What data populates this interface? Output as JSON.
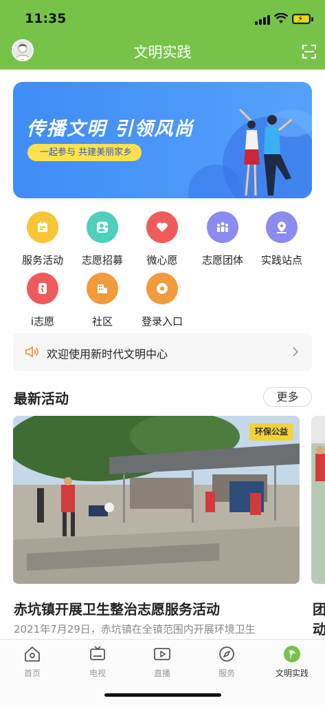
{
  "status_bar": {
    "time": "11:35"
  },
  "header": {
    "title": "文明实践",
    "avatar": "user-avatar",
    "scan_icon": "scan-icon"
  },
  "banner": {
    "title": "传播文明 引领风尚",
    "subtitle": "一起参与 共建美丽家乡"
  },
  "services": [
    {
      "label": "服务活动",
      "icon": "calendar-icon",
      "color": "#f7c636"
    },
    {
      "label": "志愿招募",
      "icon": "recruit-icon",
      "color": "#4fcfbd"
    },
    {
      "label": "微心愿",
      "icon": "heart-icon",
      "color": "#ef5a5a"
    },
    {
      "label": "志愿团体",
      "icon": "group-icon",
      "color": "#8b8bf0"
    },
    {
      "label": "实践站点",
      "icon": "location-icon",
      "color": "#8b8bf0"
    },
    {
      "label": "i志愿",
      "icon": "volunteer-icon",
      "color": "#ef5a5a"
    },
    {
      "label": "社区",
      "icon": "community-icon",
      "color": "#f39a3c"
    },
    {
      "label": "登录入口",
      "icon": "login-icon",
      "color": "#f39a3c"
    }
  ],
  "notice": {
    "text": "欢迎使用新时代文明中心",
    "icon": "speaker-icon"
  },
  "latest": {
    "title": "最新活动",
    "more_label": "更多",
    "cards": [
      {
        "tag": "环保公益",
        "title": "赤坑镇开展卫生整治志愿服务活动",
        "desc": "2021年7月29日，赤坑镇在全镇范围内开展环境卫生"
      },
      {
        "title": "团",
        "desc": "动"
      }
    ]
  },
  "tabs": [
    {
      "label": "首页",
      "icon": "home-icon"
    },
    {
      "label": "电视",
      "icon": "tv-icon"
    },
    {
      "label": "直播",
      "icon": "live-icon"
    },
    {
      "label": "服务",
      "icon": "compass-icon"
    },
    {
      "label": "文明实践",
      "icon": "practice-icon",
      "active": true
    }
  ],
  "colors": {
    "primary_green": "#77c34a",
    "banner_blue": "#4a96f8",
    "tag_yellow": "#f2d13a"
  }
}
